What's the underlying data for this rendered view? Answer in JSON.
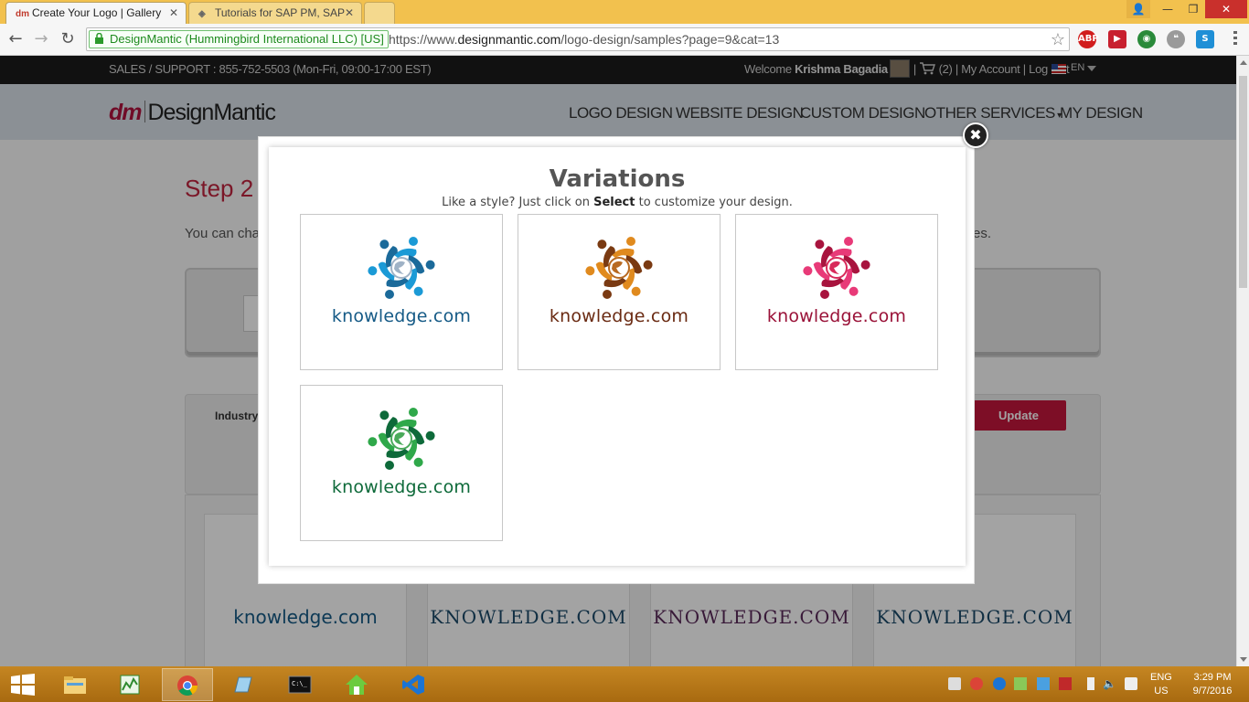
{
  "browser": {
    "tabs": [
      {
        "label": "Create Your Logo | Gallery",
        "favicon": "dm-favicon",
        "active": true
      },
      {
        "label": "Tutorials for SAP PM, SAP",
        "favicon": "sap-favicon",
        "active": false
      }
    ],
    "security_label": "DesignMantic (Hummingbird International LLC) [US]",
    "url_scheme": "https://www.",
    "url_host": "designmantic.com",
    "url_path": "/logo-design/samples?page=9&cat=13",
    "extensions": [
      {
        "name": "adblock-plus-icon",
        "label": "ABP",
        "color": "#d11d1d"
      },
      {
        "name": "forward-extension-icon",
        "label": "▶",
        "color": "#c8202f"
      },
      {
        "name": "circle-extension-icon",
        "label": "◉",
        "color": "#2a8a3a"
      },
      {
        "name": "hangouts-icon",
        "label": "❝",
        "color": "#9a9a9a"
      },
      {
        "name": "skype-icon",
        "label": "S",
        "color": "#1f8fd6"
      }
    ]
  },
  "site": {
    "sales_support": "SALES / SUPPORT : 855-752-5503 (Mon-Fri, 09:00-17:00 EST)",
    "welcome_prefix": "Welcome",
    "user_name": "Krishma Bagadia",
    "cart_count": "(2)",
    "my_account": "My Account",
    "log_out": "Log Out",
    "language": "EN",
    "logo_dm": "dm",
    "logo_name": "DesignMantic",
    "nav": [
      "LOGO DESIGN",
      "WEBSITE DESIGN",
      "CUSTOM DESIGN",
      "OTHER SERVICES",
      "MY DESIGN"
    ],
    "step_title": "Step 2",
    "desc_start": "You can cha",
    "desc_end": "es.",
    "industry_label": "Industry",
    "update_button": "Update",
    "gallery_texts": [
      "knowledge.com",
      "KNOWLEDGE.COM",
      "KNOWLEDGE.COM",
      "KNOWLEDGE.COM"
    ]
  },
  "modal": {
    "title": "Variations",
    "subtitle_prefix": "Like a style? Just click on",
    "subtitle_bold": "Select",
    "subtitle_suffix": "to customize your design.",
    "close_symbol": "✖",
    "variations": [
      {
        "text": "knowledge.com",
        "colors": [
          "#1b9ad6",
          "#1b6a9a",
          "#9fb2c6"
        ],
        "text_color": "#155a86"
      },
      {
        "text": "knowledge.com",
        "colors": [
          "#e08a1e",
          "#7a3a12",
          "#b86a22"
        ],
        "text_color": "#6a2a12"
      },
      {
        "text": "knowledge.com",
        "colors": [
          "#e83a78",
          "#a8143e",
          "#d82a5a"
        ],
        "text_color": "#9a1238"
      },
      {
        "text": "knowledge.com",
        "colors": [
          "#2fa84a",
          "#0e6a3a",
          "#4aaa5a"
        ],
        "text_color": "#0e6a3a"
      }
    ]
  },
  "taskbar": {
    "apps": [
      "file-explorer-icon",
      "taskmgr-icon",
      "chrome-icon",
      "notepad-icon",
      "cmd-icon",
      "home-app-icon",
      "visual-studio-icon"
    ],
    "lang_top": "ENG",
    "lang_bottom": "US",
    "time": "3:29 PM",
    "date": "9/7/2016"
  }
}
